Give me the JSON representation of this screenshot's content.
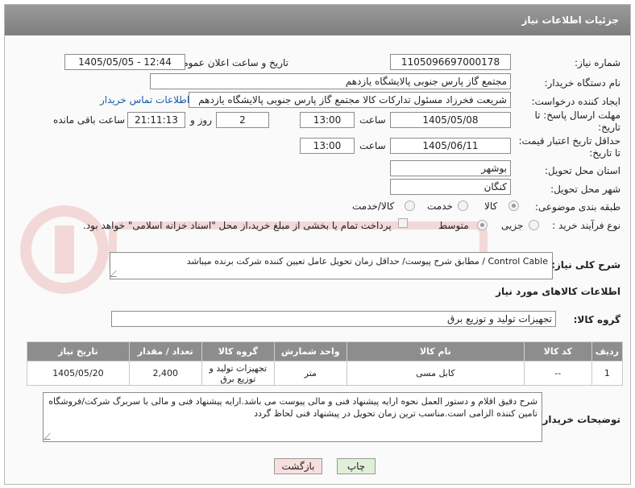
{
  "header": {
    "title": "جزئیات اطلاعات نیاز"
  },
  "fields": {
    "need_number_label": "شماره نیاز:",
    "need_number": "1105096697000178",
    "announce_label": "تاریخ و ساعت اعلان عمومی:",
    "announce_value": "1405/05/05 - 12:44",
    "buyer_label": "نام دستگاه خریدار:",
    "buyer_value": "مجتمع گاز پارس جنوبی  پالایشگاه یازدهم",
    "creator_label": "ایجاد کننده درخواست:",
    "creator_value": "شریعت فخرزاد مسئول تدارکات کالا مجتمع گاز پارس جنوبی  پالایشگاه یازدهم",
    "contact_link": "اطلاعات تماس خریدار",
    "deadline_label_1": "مهلت ارسال پاسخ: تا",
    "deadline_label_2": "تاریخ:",
    "deadline_date": "1405/05/08",
    "time_label": "ساعت",
    "deadline_time": "13:00",
    "days_value": "2",
    "days_label": "روز و",
    "remaining_value": "21:11:13",
    "remaining_label": "ساعت باقی مانده",
    "validity_label_1": "حداقل تاریخ اعتبار قیمت:",
    "validity_label_2": "تا تاریخ:",
    "validity_date": "1405/06/11",
    "validity_time": "13:00",
    "province_label": "استان محل تحویل:",
    "province_value": "بوشهر",
    "city_label": "شهر محل تحویل:",
    "city_value": "کنگان",
    "category_label": "طبقه بندی موضوعی:",
    "category_options": [
      "کالا",
      "خدمت",
      "کالا/خدمت"
    ],
    "process_label": "نوع فرآیند خرید :",
    "process_options": [
      "جزیی",
      "متوسط"
    ],
    "payment_note": "پرداخت تمام یا بخشی از مبلغ خرید،از محل \"اسناد خزانه اسلامی\" خواهد بود."
  },
  "general_desc": {
    "label": "شرح کلی نیاز:",
    "value": "Control Cable / مطابق شرح پیوست/ حداقل زمان تحویل عامل تعیین کننده شرکت برنده میباشد"
  },
  "goods_info_title": "اطلاعات کالاهای مورد نیاز",
  "goods_group": {
    "label": "گروه کالا:",
    "value": "تجهیزات تولید و توزیع برق"
  },
  "table": {
    "headers": [
      "ردیف",
      "کد کالا",
      "نام کالا",
      "واحد شمارش",
      "گروه کالا",
      "تعداد / مقدار",
      "تاریخ نیاز"
    ],
    "rows": [
      [
        "1",
        "--",
        "کابل مسی",
        "متر",
        "تجهیزات تولید و توزیع برق",
        "2,400",
        "1405/05/20"
      ]
    ]
  },
  "buyer_notes": {
    "label": "توضیحات خریدار:",
    "value": "شرح دقیق اقلام و دستور العمل نحوه ارایه پیشنهاد فنی و مالی پیوست می باشد.ارایه پیشنهاد فنی و مالی با سربرگ شرکت/فروشگاه تامین کننده الزامی است.مناسب ترین زمان تحویل در پیشنهاد فنی لحاظ گردد"
  },
  "buttons": {
    "print": "چاپ",
    "back": "بازگشت"
  },
  "colors": {
    "header_bg": "#8b8b8b",
    "link": "#1a5aa8",
    "print_bg": "#dff0d8",
    "back_bg": "#f9dede"
  }
}
